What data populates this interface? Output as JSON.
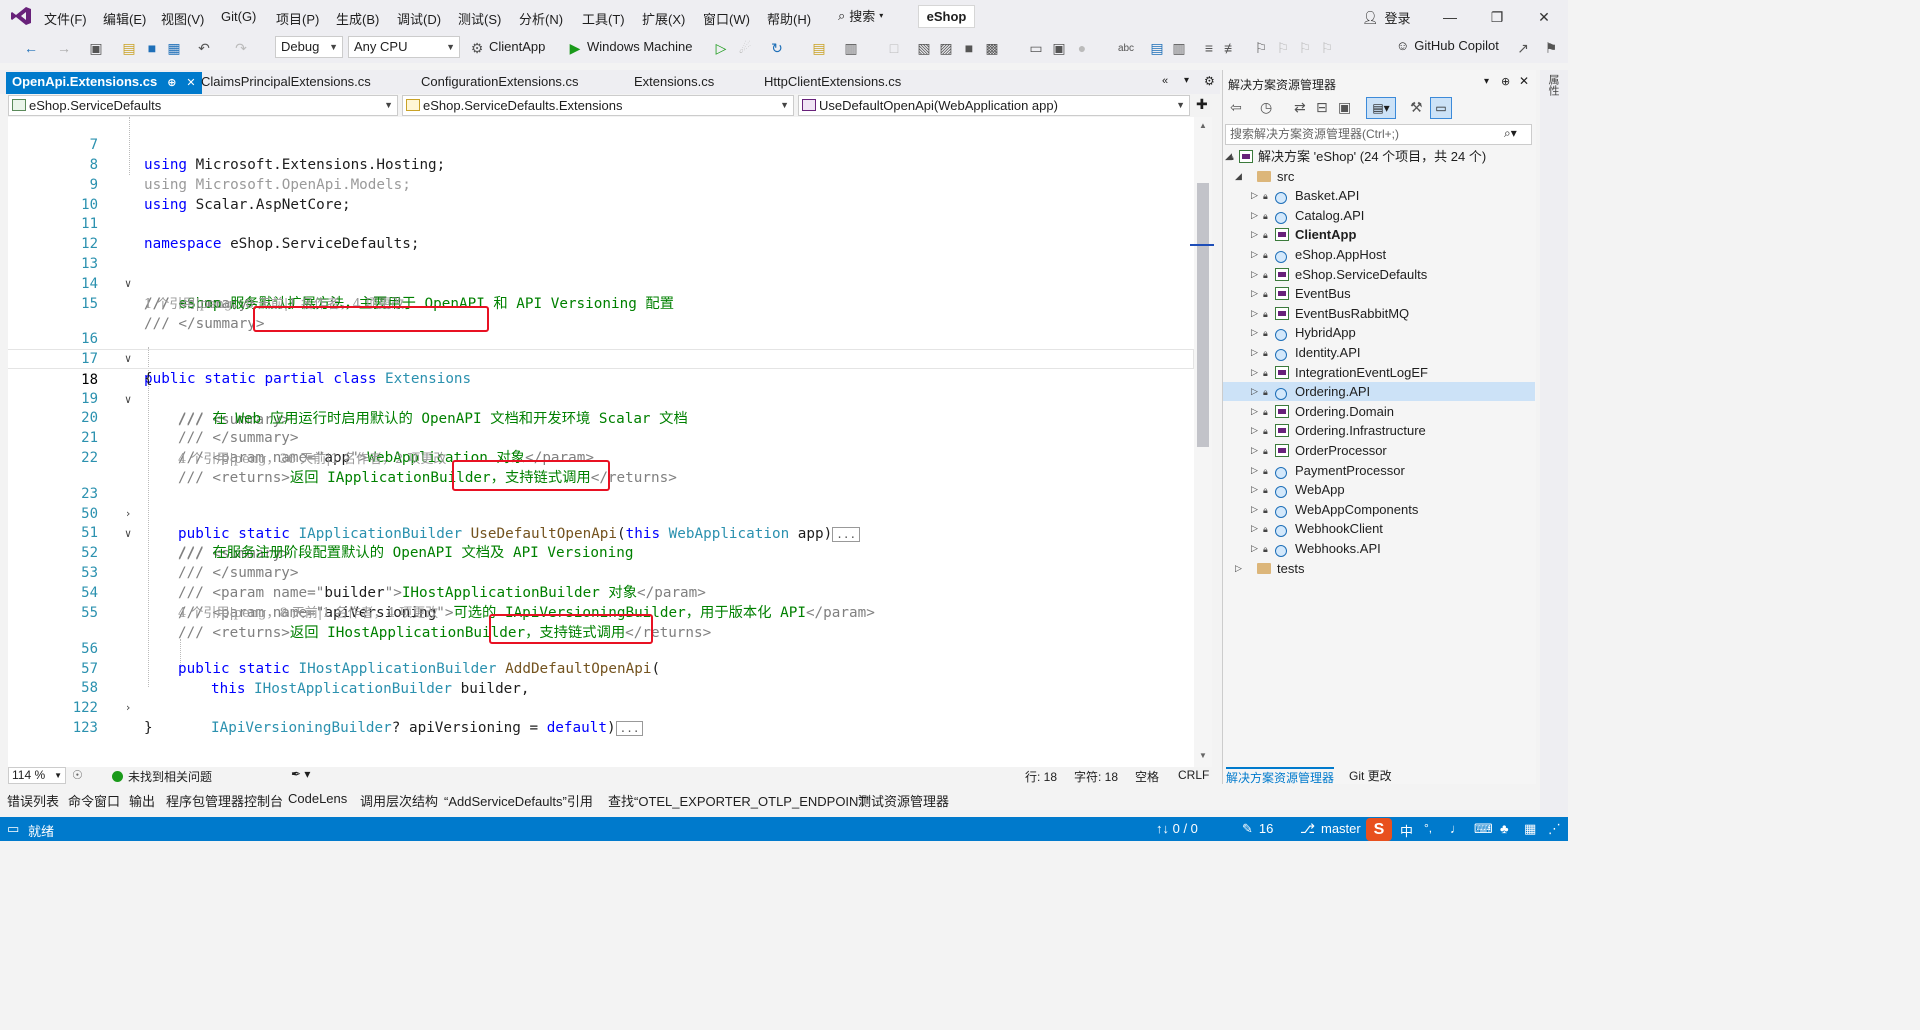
{
  "menu": {
    "items": [
      "文件(F)",
      "编辑(E)",
      "视图(V)",
      "Git(G)",
      "项目(P)",
      "生成(B)",
      "调试(D)",
      "测试(S)",
      "分析(N)",
      "工具(T)",
      "扩展(X)",
      "窗口(W)",
      "帮助(H)"
    ],
    "search_label": "搜索",
    "solution_name": "eShop",
    "login_label": "登录"
  },
  "toolbar": {
    "config": "Debug",
    "platform": "Any CPU",
    "startup_project": "ClientApp",
    "run_target": "Windows Machine",
    "copilot_label": "GitHub Copilot"
  },
  "tabs": [
    {
      "label": "OpenApi.Extensions.cs",
      "active": true
    },
    {
      "label": "ClaimsPrincipalExtensions.cs",
      "active": false
    },
    {
      "label": "ConfigurationExtensions.cs",
      "active": false
    },
    {
      "label": "Extensions.cs",
      "active": false
    },
    {
      "label": "HttpClientExtensions.cs",
      "active": false
    }
  ],
  "navbar": {
    "project": "eShop.ServiceDefaults",
    "type": "eShop.ServiceDefaults.Extensions",
    "member": "UseDefaultOpenApi(WebApplication app)"
  },
  "code": {
    "l7": {
      "num": "7",
      "kw": "using",
      "rest": " Microsoft.Extensions.Hosting;"
    },
    "l8": {
      "num": "8",
      "text": "using Microsoft.OpenApi.Models;"
    },
    "l9": {
      "num": "9",
      "kw": "using",
      "rest": " Scalar.AspNetCore;"
    },
    "l10": {
      "num": "10"
    },
    "l11": {
      "num": "11",
      "kw": "namespace",
      "rest": " eShop.ServiceDefaults;"
    },
    "l12": {
      "num": "12"
    },
    "l13": {
      "num": "13",
      "dg1": "///",
      "dg2": " <summary>"
    },
    "l14": {
      "num": "14",
      "dg1": "///",
      "cm": " eShop 服务默认扩展方法，主要用于 OpenAPI 和 API Versioning 配置"
    },
    "l15": {
      "num": "15",
      "dg1": "///",
      "dg2": " </summary>"
    },
    "lens16": "1 个引用|peng，8 天前|1 名作者，4 项更改",
    "l16": {
      "num": "16",
      "kw1": "public",
      "kw2": " static",
      "kw3": " partial",
      "kw4": " class",
      "ty": " Extensions"
    },
    "l17": {
      "num": "17",
      "text": "{"
    },
    "l18": {
      "num": "18",
      "dg1": "///",
      "dg2": " <summary>"
    },
    "l19": {
      "num": "19",
      "dg1": "///",
      "cm": " 在 Web 应用运行时启用默认的 OpenAPI 文档和开发环境 Scalar 文档"
    },
    "l20": {
      "num": "20",
      "dg1": "///",
      "dg2": " </summary>"
    },
    "l21": {
      "num": "21",
      "dg1": "///",
      "dg2": " <param name=\"",
      "param": "app",
      "dg3": "\">",
      "cm": "WebApplication 对象",
      "dg4": "</param>"
    },
    "l22": {
      "num": "22",
      "dg1": "///",
      "dg2": " <returns>",
      "cm": "返回 IApplicationBuilder，支持链式调用",
      "dg4": "</returns>"
    },
    "lens23": "4 个引用|peng，36 天前|1 名作者，2 项更改",
    "l23": {
      "num": "23",
      "kw1": "public",
      "kw2": " static",
      "ty1": " IApplicationBuilder",
      "mt": " UseDefaultOpenApi",
      "p1": "(",
      "kw3": "this",
      "ty2": " WebApplication",
      "rest": " app)",
      "ellipsis": "..."
    },
    "l50": {
      "num": "50",
      "dg1": "///",
      "dg2": " <summary>"
    },
    "l51": {
      "num": "51",
      "dg1": "///",
      "cm": " 在服务注册阶段配置默认的 OpenAPI 文档及 API Versioning"
    },
    "l52": {
      "num": "52",
      "dg1": "///",
      "dg2": " </summary>"
    },
    "l53": {
      "num": "53",
      "dg1": "///",
      "dg2": " <param name=\"",
      "param": "builder",
      "dg3": "\">",
      "cm": "IHostApplicationBuilder 对象",
      "dg4": "</param>"
    },
    "l54": {
      "num": "54",
      "dg1": "///",
      "dg2": " <param name=\"",
      "param": "apiVersioning",
      "dg3": "\">",
      "cm": "可选的 IApiVersioningBuilder，用于版本化 API",
      "dg4": "</param>"
    },
    "l55": {
      "num": "55",
      "dg1": "///",
      "dg2": " <returns>",
      "cm": "返回 IHostApplicationBuilder，支持链式调用",
      "dg4": "</returns>"
    },
    "lens56": "4 个引用|peng，8 天前|1 名作者，4 项更改",
    "l56": {
      "num": "56",
      "kw1": "public",
      "kw2": " static",
      "ty1": " IHostApplicationBuilder",
      "mt": " AddDefaultOpenApi",
      "p1": "("
    },
    "l57": {
      "num": "57",
      "kw": "this",
      "ty": " IHostApplicationBuilder",
      "rest": " builder,"
    },
    "l58": {
      "num": "58",
      "ty": "IApiVersioningBuilder",
      "rest": "? apiVersioning = ",
      "kw": "default",
      "p": ")",
      "ellipsis": "..."
    },
    "l122": {
      "num": "122",
      "text": "}"
    },
    "l123": {
      "num": "123"
    }
  },
  "editor_status": {
    "zoom": "114 %",
    "issues": "未找到相关问题",
    "line": "行: 18",
    "col": "字符: 18",
    "whitespace": "空格",
    "eol": "CRLF"
  },
  "bottom_tabs": [
    "错误列表",
    "命令窗口",
    "输出",
    "程序包管理器控制台",
    "CodeLens",
    "调用层次结构",
    "“AddServiceDefaults”引用",
    "查找“OTEL_EXPORTER_OTLP_ENDPOINT”",
    "测试资源管理器"
  ],
  "statusbar": {
    "ready": "就绪",
    "sync": "↑↓ 0 / 0",
    "edits": "16",
    "branch": "master",
    "ime": "中"
  },
  "solution_explorer": {
    "title": "解决方案资源管理器",
    "search_placeholder": "搜索解决方案资源管理器(Ctrl+;)",
    "solution_label": "解决方案 'eShop' (24 个项目，共 24 个)",
    "src": "src",
    "projects": [
      "Basket.API",
      "Catalog.API",
      "ClientApp",
      "eShop.AppHost",
      "eShop.ServiceDefaults",
      "EventBus",
      "EventBusRabbitMQ",
      "HybridApp",
      "Identity.API",
      "IntegrationEventLogEF",
      "Ordering.API",
      "Ordering.Domain",
      "Ordering.Infrastructure",
      "OrderProcessor",
      "PaymentProcessor",
      "WebApp",
      "WebAppComponents",
      "WebhookClient",
      "Webhooks.API"
    ],
    "tests": "tests",
    "bottom_tab_1": "解决方案资源管理器",
    "bottom_tab_2": "Git 更改"
  },
  "colors": {
    "accent": "#007acc",
    "keyword": "#0000ff",
    "type": "#2b91af",
    "comment": "#008000",
    "highlight_box": "#e81123"
  }
}
